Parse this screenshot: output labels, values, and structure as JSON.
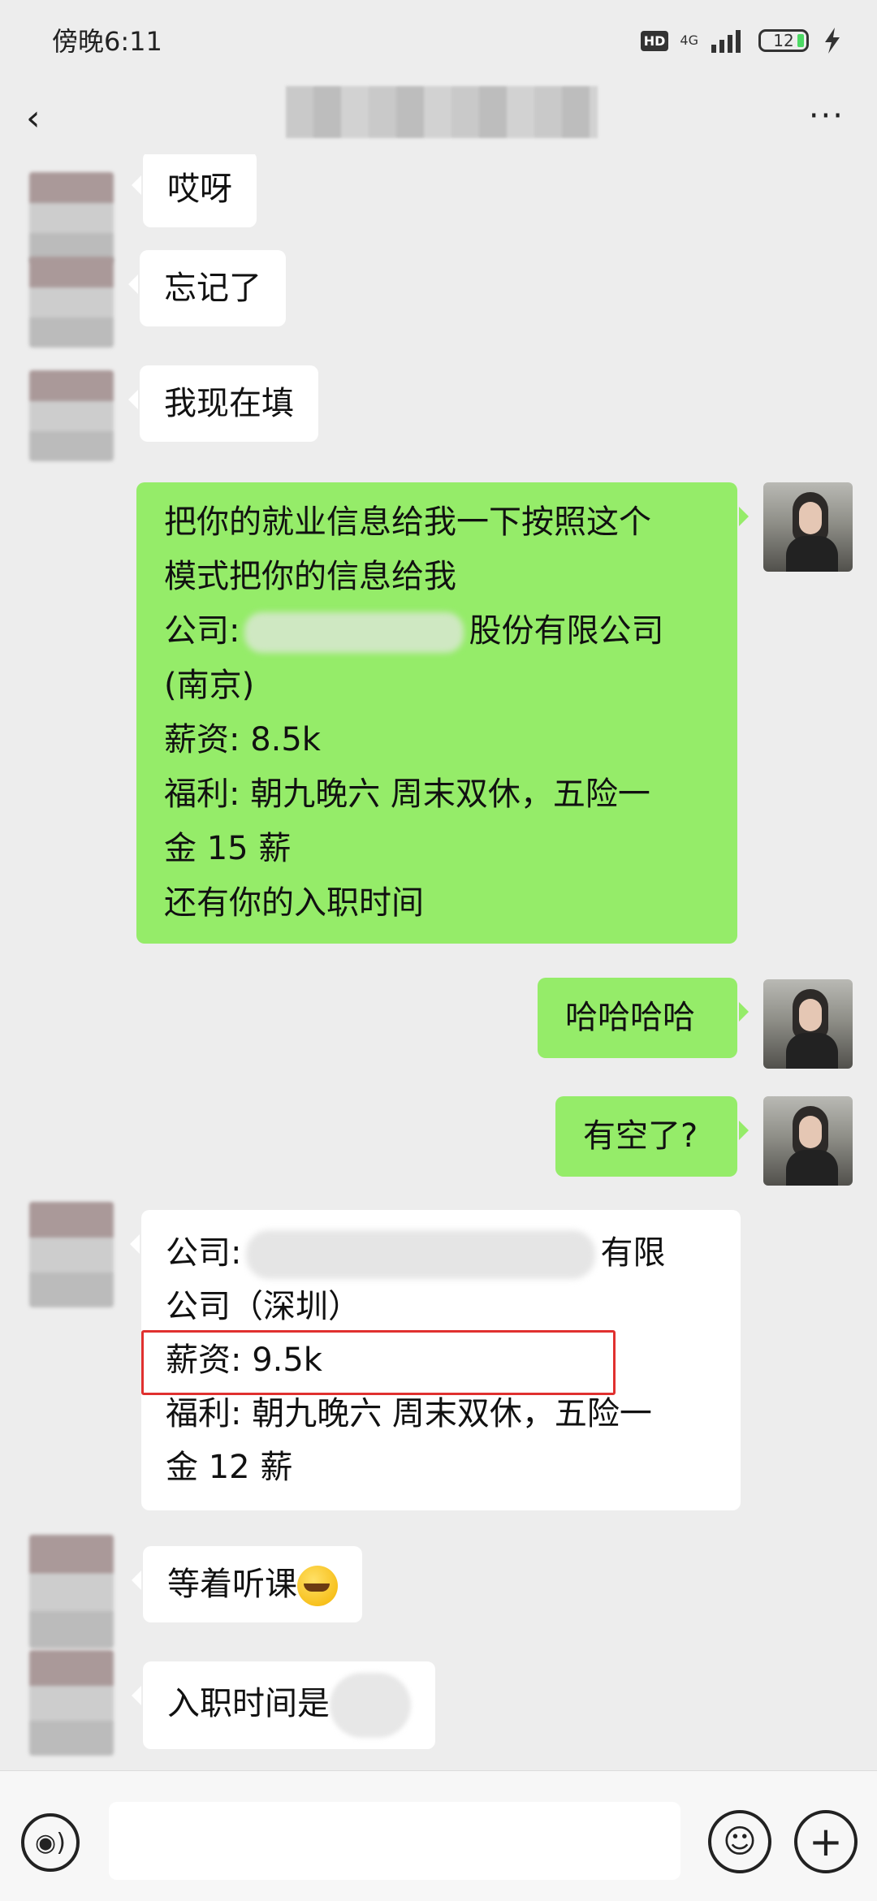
{
  "status_bar": {
    "time": "傍晚6:11",
    "hd": "HD",
    "network": "4G",
    "battery": "12"
  },
  "header": {
    "back_icon": "‹",
    "more_icon": "···"
  },
  "messages": {
    "m1": "哎呀",
    "m2": "忘记了",
    "m3": "我现在填",
    "m4_lines": [
      "把你的就业信息给我一下按照这个",
      "模式把你的信息给我",
      "公司:",
      "股份有限公司",
      "(南京)",
      "薪资: 8.5k",
      "福利: 朝九晚六 周末双休，五险一",
      "金 15 薪",
      "还有你的入职时间"
    ],
    "m5": "哈哈哈哈",
    "m6": "有空了?",
    "m7_lines": [
      "公司:",
      "有限",
      "公司（深圳）",
      "薪资: 9.5k",
      "福利: 朝九晚六 周末双休，五险一",
      "金 12 薪"
    ],
    "m8": "等着听课",
    "m9": "入职时间是"
  },
  "input_bar": {
    "placeholder": "",
    "voice_icon": "◉)",
    "emoji_icon": "☺",
    "plus_icon": "+"
  },
  "colors": {
    "sent_bubble": "#95ec69",
    "received_bubble": "#ffffff",
    "background": "#ededed",
    "highlight": "#e0302f"
  }
}
